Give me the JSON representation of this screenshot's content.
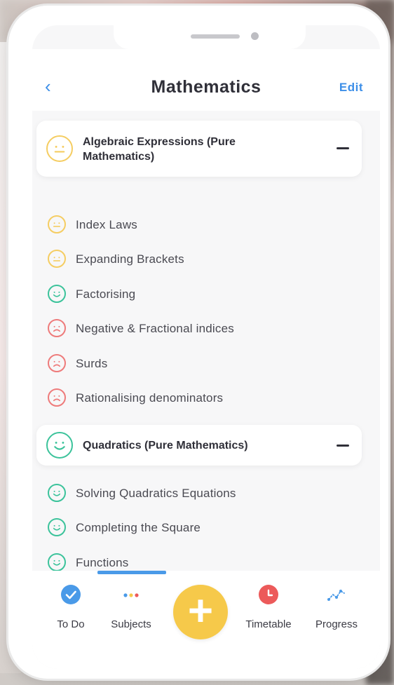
{
  "nav": {
    "back_glyph": "‹",
    "title": "Mathematics",
    "edit_label": "Edit"
  },
  "sections": [
    {
      "title": "Algebraic Expressions (Pure Mathematics)",
      "mood": "neutral",
      "collapse_glyph": "−",
      "topics": [
        {
          "label": "Index Laws",
          "mood": "neutral"
        },
        {
          "label": "Expanding Brackets",
          "mood": "neutral"
        },
        {
          "label": "Factorising",
          "mood": "happy"
        },
        {
          "label": "Negative & Fractional indices",
          "mood": "sad"
        },
        {
          "label": "Surds",
          "mood": "sad"
        },
        {
          "label": "Rationalising denominators",
          "mood": "sad"
        }
      ]
    },
    {
      "title": "Quadratics (Pure Mathematics)",
      "mood": "happy",
      "collapse_glyph": "−",
      "topics": [
        {
          "label": "Solving Quadratics Equations",
          "mood": "happy"
        },
        {
          "label": "Completing the Square",
          "mood": "happy"
        },
        {
          "label": "Functions",
          "mood": "happy"
        }
      ]
    }
  ],
  "tabbar": {
    "tabs": [
      {
        "label": "To Do",
        "icon": "check-circle-icon"
      },
      {
        "label": "Subjects",
        "icon": "dots-icon"
      },
      {
        "label": "Timetable",
        "icon": "clock-icon"
      },
      {
        "label": "Progress",
        "icon": "trend-line-icon"
      }
    ],
    "add_glyph": "+",
    "active_tab": "Subjects"
  },
  "colors": {
    "accent_blue": "#4a9ae8",
    "mood_neutral": "#f5cd62",
    "mood_happy": "#3cc39b",
    "mood_sad": "#ee7b7b",
    "add_yellow": "#f6c94a",
    "timetable_red": "#ec5a5a"
  }
}
